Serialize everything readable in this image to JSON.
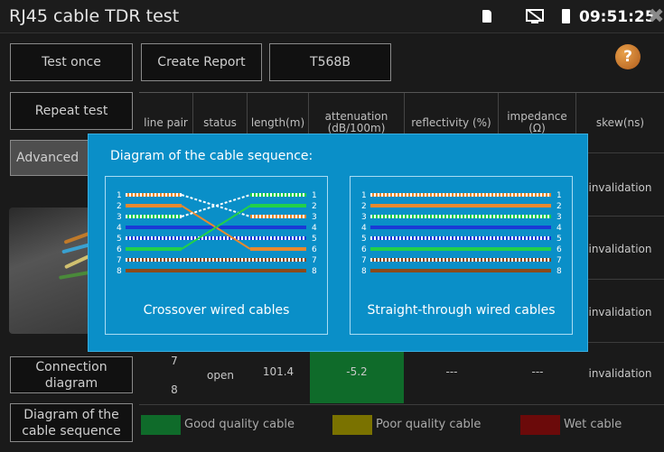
{
  "window": {
    "title": "RJ45 cable TDR test",
    "time": "09:51:25"
  },
  "buttons": {
    "test_once": "Test once",
    "create_report": "Create Report",
    "standard": "T568B",
    "repeat_test": "Repeat test",
    "advanced": "Advanced",
    "connection_diagram": "Connection diagram",
    "cable_sequence": "Diagram of the cable sequence"
  },
  "table": {
    "headers": [
      "line pair",
      "status",
      "length(m)",
      "attenuation (dB/100m)",
      "reflectivity (%)",
      "impedance (Ω)",
      "skew(ns)"
    ],
    "skew_values": [
      "invalidation",
      "invalidation",
      "invalidation",
      "invalidation"
    ],
    "last_row": {
      "pair_top": "7",
      "pair_bottom": "8",
      "status": "open",
      "length": "101.4",
      "attenuation": "-5.2",
      "reflectivity": "---",
      "impedance": "---"
    }
  },
  "legend": [
    {
      "label": "Good quality cable",
      "color": "#0f6b2a"
    },
    {
      "label": "Poor quality cable",
      "color": "#7a7200"
    },
    {
      "label": "Wet cable",
      "color": "#6b0a0a"
    }
  ],
  "dialog": {
    "title": "Diagram of the cable sequence:",
    "crossover_label": "Crossover wired cables",
    "straight_label": "Straight-through wired cables",
    "pin_numbers": [
      "1",
      "2",
      "3",
      "4",
      "5",
      "6",
      "7",
      "8"
    ]
  },
  "icons": {
    "sd": "sd-card-icon",
    "screen": "screen-off-icon",
    "battery": "battery-icon",
    "close": "close-icon",
    "help": "help-icon"
  }
}
